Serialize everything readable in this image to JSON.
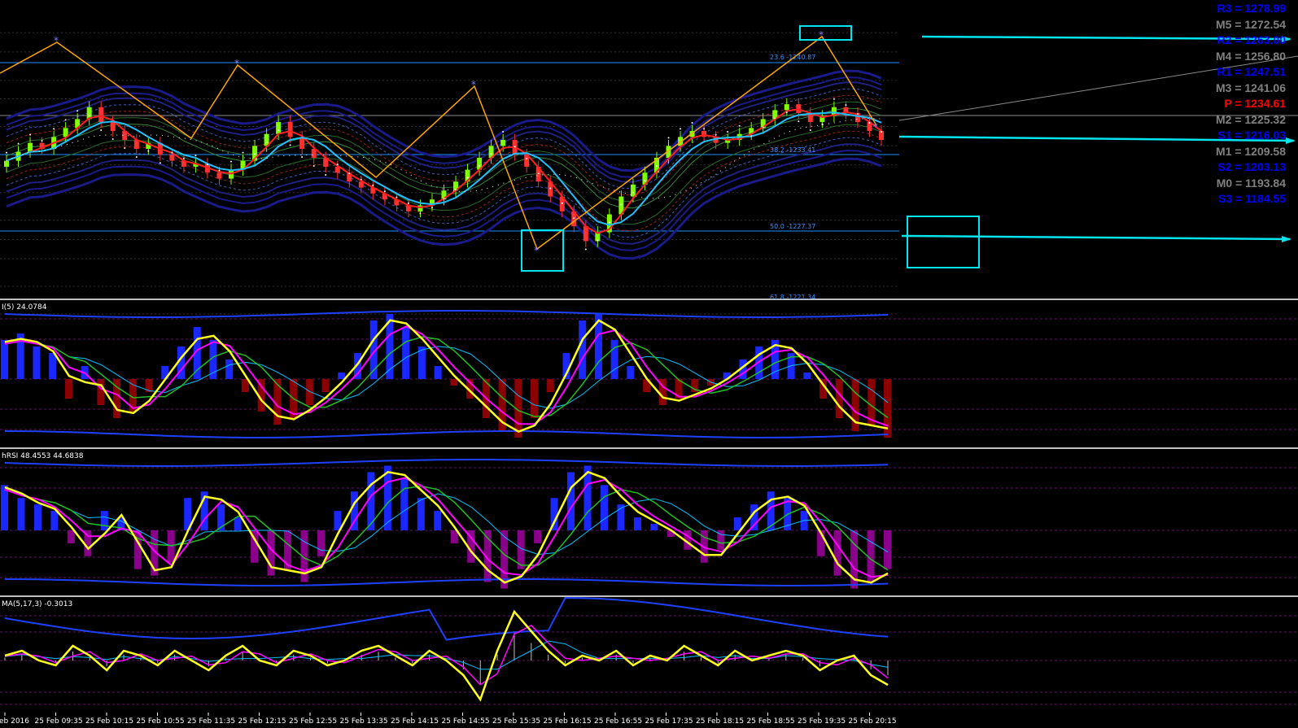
{
  "chart_data": [
    {
      "type": "candlestick",
      "panel": "price",
      "xlabel": "",
      "ylabel": "",
      "pivot_levels": [
        {
          "label": "R3 = 1278.99",
          "color": "#0000ff"
        },
        {
          "label": "M5 = 1272.54",
          "color": "#808080"
        },
        {
          "label": "R2 = 1263.00",
          "color": "#0000ff"
        },
        {
          "label": "M4 = 1256.80",
          "color": "#808080"
        },
        {
          "label": "R1 = 1247.51",
          "color": "#0000ff"
        },
        {
          "label": "M3 = 1241.06",
          "color": "#808080"
        },
        {
          "label": "P  = 1234.61",
          "color": "#ff0000"
        },
        {
          "label": "M2 = 1225.32",
          "color": "#808080"
        },
        {
          "label": "S1 = 1216.03",
          "color": "#0000ff"
        },
        {
          "label": "M1 = 1209.58",
          "color": "#808080"
        },
        {
          "label": "S2 = 1203.13",
          "color": "#0000ff"
        },
        {
          "label": "M0 = 1193.84",
          "color": "#808080"
        },
        {
          "label": "S3 = 1184.55",
          "color": "#0000ff"
        }
      ],
      "fib_levels": [
        {
          "label": "23.6 -1240.87"
        },
        {
          "label": "38.2 -1233.41"
        },
        {
          "label": "50.0 -1227.37"
        },
        {
          "label": "61.8 -1221.34"
        }
      ],
      "close": [
        1236,
        1239,
        1242,
        1240,
        1244,
        1247,
        1250,
        1254,
        1249,
        1246,
        1243,
        1240,
        1242,
        1238,
        1236,
        1234,
        1235,
        1232,
        1230,
        1233,
        1236,
        1241,
        1245,
        1249,
        1244,
        1240,
        1237,
        1234,
        1232,
        1229,
        1227,
        1225,
        1223,
        1221,
        1219,
        1221,
        1223,
        1226,
        1229,
        1233,
        1237,
        1241,
        1243,
        1238,
        1234,
        1229,
        1224,
        1219,
        1214,
        1209,
        1212,
        1218,
        1224,
        1228,
        1232,
        1237,
        1241,
        1244,
        1246,
        1244,
        1242,
        1243,
        1245,
        1247,
        1250,
        1253,
        1255,
        1252,
        1249,
        1251,
        1254,
        1252,
        1249,
        1246,
        1243
      ],
      "x_ticks": [
        "25 Feb 2016",
        "25 Feb 09:35",
        "25 Feb 10:15",
        "25 Feb 10:55",
        "25 Feb 11:35",
        "25 Feb 12:15",
        "25 Feb 12:55",
        "25 Feb 13:35",
        "25 Feb 14:15",
        "25 Feb 14:55",
        "25 Feb 15:35",
        "25 Feb 16:15",
        "25 Feb 16:55",
        "25 Feb 17:35",
        "25 Feb 18:15",
        "25 Feb 18:55",
        "25 Feb 19:35",
        "25 Feb 20:15"
      ]
    },
    {
      "type": "histogram",
      "panel": "indicator-1",
      "label": "I(5) 24.0784",
      "values": [
        0.6,
        0.7,
        0.5,
        0.4,
        -0.3,
        0.2,
        -0.4,
        -0.6,
        -0.5,
        -0.2,
        0.2,
        0.5,
        0.8,
        0.6,
        0.3,
        -0.2,
        -0.5,
        -0.7,
        -0.6,
        -0.4,
        -0.2,
        0.1,
        0.4,
        0.9,
        1.0,
        0.8,
        0.5,
        0.2,
        -0.1,
        -0.3,
        -0.6,
        -0.8,
        -0.9,
        -0.6,
        -0.2,
        0.4,
        0.9,
        1.0,
        0.6,
        0.2,
        -0.2,
        -0.4,
        -0.3,
        -0.2,
        -0.1,
        0.1,
        0.3,
        0.5,
        0.6,
        0.4,
        0.1,
        -0.3,
        -0.6,
        -0.8,
        -0.7,
        -0.9
      ],
      "range": [
        -1,
        1
      ]
    },
    {
      "type": "histogram",
      "panel": "indicator-2",
      "label": "hRSI 48.4553 44.6838",
      "values": [
        0.7,
        0.5,
        0.4,
        0.3,
        -0.2,
        -0.4,
        0.3,
        0.2,
        -0.6,
        -0.7,
        -0.5,
        0.5,
        0.6,
        0.4,
        0.2,
        -0.5,
        -0.7,
        -0.6,
        -0.8,
        -0.4,
        0.3,
        0.6,
        0.9,
        1.0,
        0.8,
        0.5,
        0.3,
        -0.2,
        -0.5,
        -0.8,
        -0.9,
        -0.6,
        -0.2,
        0.5,
        0.9,
        1.0,
        0.7,
        0.4,
        0.2,
        0.1,
        -0.1,
        -0.3,
        -0.5,
        -0.3,
        0.2,
        0.4,
        0.6,
        0.5,
        0.3,
        -0.4,
        -0.7,
        -0.9,
        -0.8,
        -0.6
      ],
      "range": [
        -1,
        1
      ]
    },
    {
      "type": "line",
      "panel": "indicator-3",
      "label": "MA(5,17,3) -0.3013",
      "values": [
        0.1,
        0.2,
        0.0,
        -0.1,
        0.3,
        0.1,
        -0.2,
        0.2,
        0.1,
        -0.1,
        0.2,
        0.0,
        -0.2,
        0.1,
        0.3,
        0.0,
        -0.1,
        0.2,
        0.1,
        -0.1,
        0.0,
        0.2,
        0.3,
        0.1,
        -0.1,
        0.2,
        0.0,
        -0.3,
        -0.8,
        0.2,
        1.0,
        0.6,
        0.2,
        -0.1,
        0.1,
        0.0,
        0.2,
        -0.1,
        0.1,
        0.0,
        0.3,
        0.1,
        -0.1,
        0.2,
        0.0,
        0.1,
        0.2,
        0.1,
        -0.2,
        0.0,
        0.1,
        -0.3,
        -0.5
      ],
      "range": [
        -1,
        1
      ]
    }
  ]
}
